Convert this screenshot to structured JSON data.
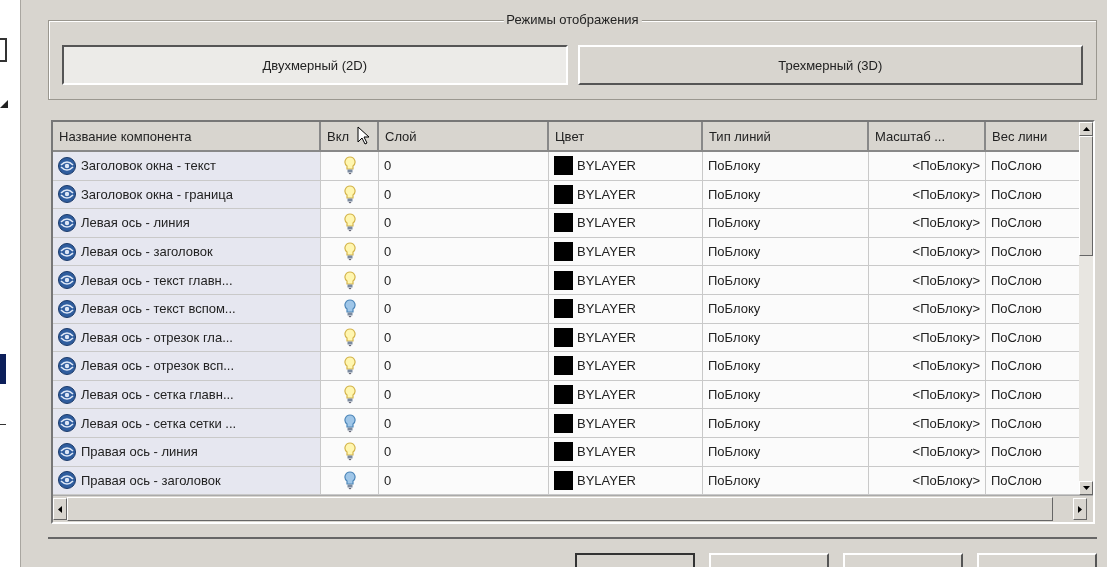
{
  "display_modes": {
    "title": "Режимы отображения",
    "buttons": [
      {
        "label": "Двухмерный (2D)",
        "selected": true
      },
      {
        "label": "Трехмерный (3D)",
        "selected": false
      }
    ]
  },
  "table": {
    "columns": [
      "Название компонента",
      "Вкл",
      "Слой",
      "Цвет",
      "Тип линий",
      "Масштаб ...",
      "Вес лини"
    ],
    "rows": [
      {
        "name": "Заголовок окна - текст",
        "on": true,
        "layer": "0",
        "color_name": "BYLAYER",
        "linetype": "ПоБлоку",
        "scale": "<ПоБлоку>",
        "weight": "ПоСлою"
      },
      {
        "name": "Заголовок окна - граница",
        "on": true,
        "layer": "0",
        "color_name": "BYLAYER",
        "linetype": "ПоБлоку",
        "scale": "<ПоБлоку>",
        "weight": "ПоСлою"
      },
      {
        "name": "Левая ось - линия",
        "on": true,
        "layer": "0",
        "color_name": "BYLAYER",
        "linetype": "ПоБлоку",
        "scale": "<ПоБлоку>",
        "weight": "ПоСлою"
      },
      {
        "name": "Левая ось - заголовок",
        "on": true,
        "layer": "0",
        "color_name": "BYLAYER",
        "linetype": "ПоБлоку",
        "scale": "<ПоБлоку>",
        "weight": "ПоСлою"
      },
      {
        "name": "Левая ось - текст главн...",
        "on": true,
        "layer": "0",
        "color_name": "BYLAYER",
        "linetype": "ПоБлоку",
        "scale": "<ПоБлоку>",
        "weight": "ПоСлою"
      },
      {
        "name": "Левая ось - текст вспом...",
        "on": false,
        "layer": "0",
        "color_name": "BYLAYER",
        "linetype": "ПоБлоку",
        "scale": "<ПоБлоку>",
        "weight": "ПоСлою"
      },
      {
        "name": "Левая ось - отрезок гла...",
        "on": true,
        "layer": "0",
        "color_name": "BYLAYER",
        "linetype": "ПоБлоку",
        "scale": "<ПоБлоку>",
        "weight": "ПоСлою"
      },
      {
        "name": "Левая ось - отрезок всп...",
        "on": true,
        "layer": "0",
        "color_name": "BYLAYER",
        "linetype": "ПоБлоку",
        "scale": "<ПоБлоку>",
        "weight": "ПоСлою"
      },
      {
        "name": "Левая ось - сетка главн...",
        "on": true,
        "layer": "0",
        "color_name": "BYLAYER",
        "linetype": "ПоБлоку",
        "scale": "<ПоБлоку>",
        "weight": "ПоСлою"
      },
      {
        "name": "Левая ось - сетка сетки ...",
        "on": false,
        "layer": "0",
        "color_name": "BYLAYER",
        "linetype": "ПоБлоку",
        "scale": "<ПоБлоку>",
        "weight": "ПоСлою"
      },
      {
        "name": "Правая ось - линия",
        "on": true,
        "layer": "0",
        "color_name": "BYLAYER",
        "linetype": "ПоБлоку",
        "scale": "<ПоБлоку>",
        "weight": "ПоСлою"
      },
      {
        "name": "Правая ось - заголовок",
        "on": false,
        "layer": "0",
        "color_name": "BYLAYER",
        "linetype": "ПоБлоку",
        "scale": "<ПоБлоку>",
        "weight": "ПоСлою"
      }
    ]
  }
}
